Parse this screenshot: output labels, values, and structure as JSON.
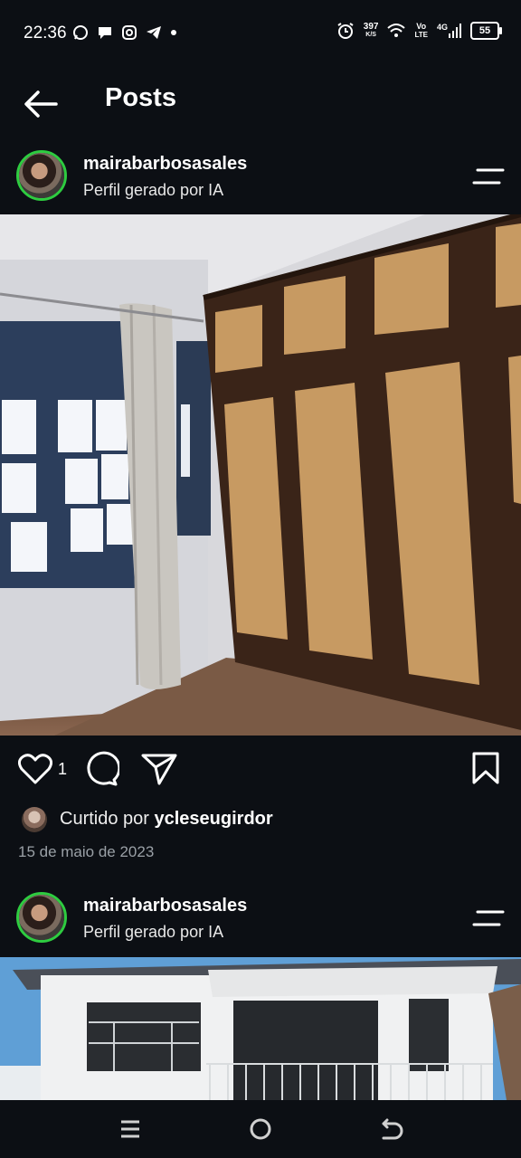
{
  "status_bar": {
    "time": "22:36",
    "net_speed_value": "397",
    "net_speed_unit": "K/S",
    "volte_top": "Vo",
    "volte_bottom": "LTE",
    "network": "4G",
    "battery": "55"
  },
  "header": {
    "title": "Posts"
  },
  "posts": [
    {
      "username": "mairabarbosasales",
      "subtitle": "Perfil gerado por IA",
      "likes": "1",
      "liked_by_prefix": "Curtido por",
      "liked_by_user": "ycleseugirdor",
      "date": "15 de maio de 2023"
    },
    {
      "username": "mairabarbosasales",
      "subtitle": "Perfil gerado por IA"
    }
  ],
  "colors": {
    "background": "#0c0f14",
    "story_ring": "#2ecc40",
    "muted_text": "#9aa0a6"
  },
  "icons": {
    "back": "arrow-left-icon",
    "menu": "menu-lines-icon",
    "like": "heart-icon",
    "comment": "comment-bubble-icon",
    "share": "send-icon",
    "save": "bookmark-icon"
  }
}
